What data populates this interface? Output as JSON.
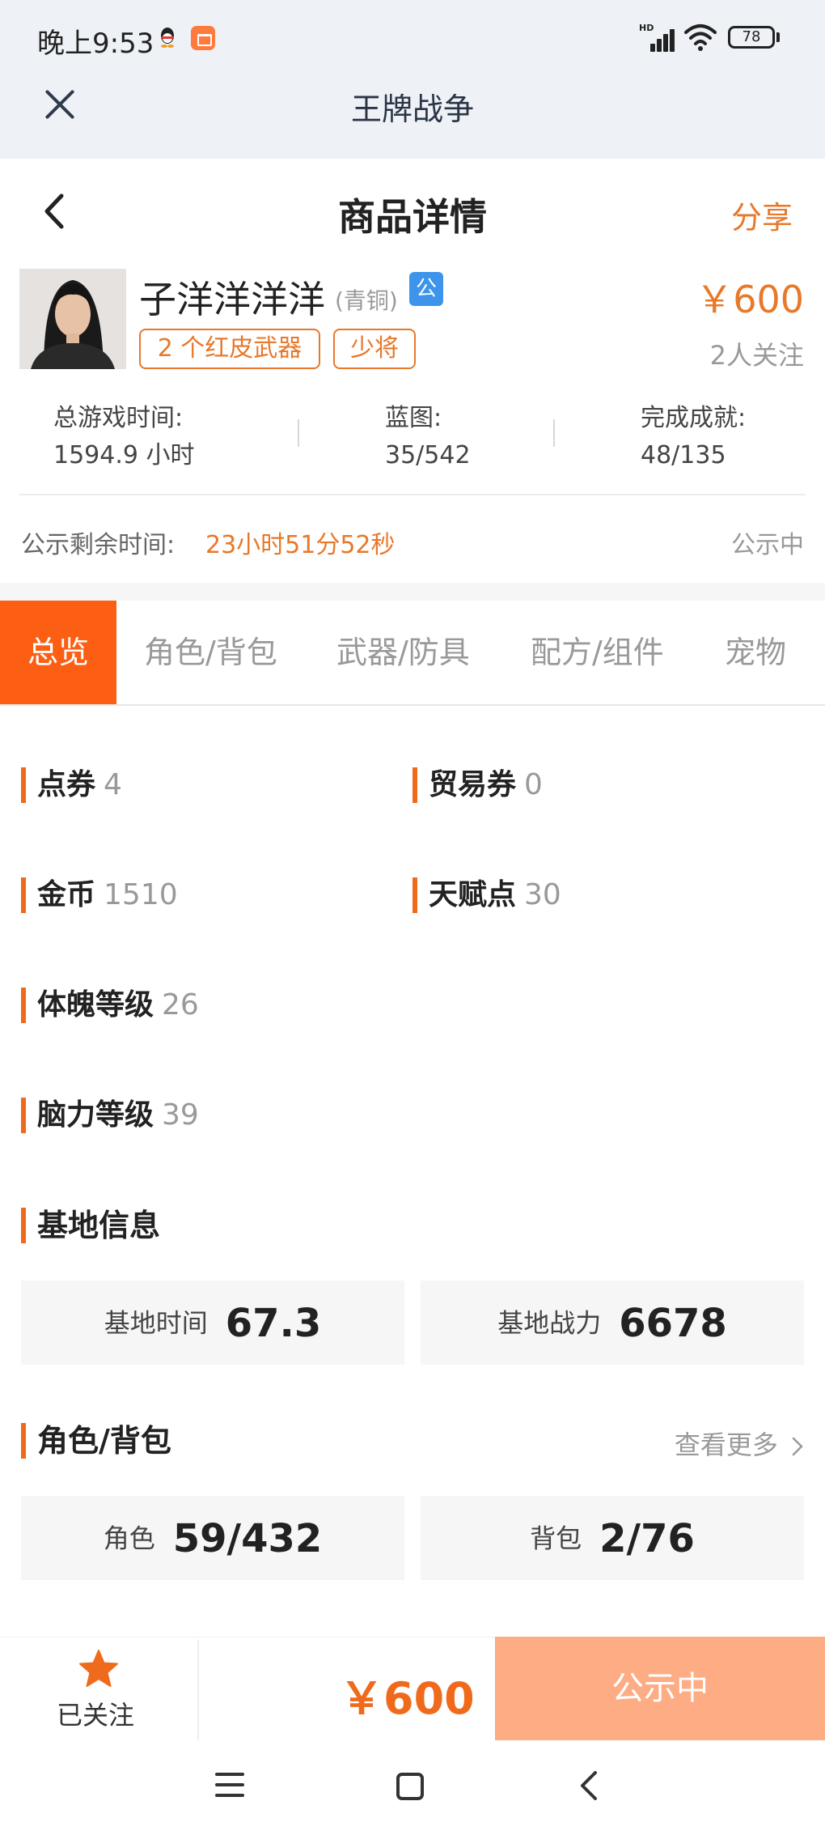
{
  "status_bar": {
    "time": "晚上9:53",
    "hd_label": "HD",
    "battery": "78"
  },
  "app_header": {
    "title": "王牌战争"
  },
  "page_header": {
    "title": "商品详情",
    "share": "分享"
  },
  "seller": {
    "name": "子洋洋洋洋",
    "rank": "(青铜)",
    "badge": "公",
    "price": "￥600",
    "tags": [
      "2 个红皮武器",
      "少将"
    ],
    "followers": "2人关注"
  },
  "stats": [
    {
      "label": "总游戏时间:",
      "value": "1594.9 小时"
    },
    {
      "label": "蓝图:",
      "value": "35/542"
    },
    {
      "label": "完成成就:",
      "value": "48/135"
    }
  ],
  "publicity": {
    "label": "公示剩余时间:",
    "remaining": "23小时51分52秒",
    "status": "公示中"
  },
  "tabs": [
    "总览",
    "角色/背包",
    "武器/防具",
    "配方/组件",
    "宠物"
  ],
  "overview": {
    "items": [
      {
        "label": "点券",
        "value": "4"
      },
      {
        "label": "贸易券",
        "value": "0"
      },
      {
        "label": "金币",
        "value": "1510"
      },
      {
        "label": "天赋点",
        "value": "30"
      },
      {
        "label": "体魄等级",
        "value": "26"
      },
      {
        "label": "脑力等级",
        "value": "39"
      }
    ],
    "base_section": {
      "title": "基地信息",
      "cards": [
        {
          "label": "基地时间",
          "value": "67.3"
        },
        {
          "label": "基地战力",
          "value": "6678"
        }
      ]
    },
    "role_section": {
      "title": "角色/背包",
      "more": "查看更多",
      "cards": [
        {
          "label": "角色",
          "value": "59/432"
        },
        {
          "label": "背包",
          "value": "2/76"
        }
      ]
    }
  },
  "bottom_bar": {
    "follow_label": "已关注",
    "price": "￥600",
    "button": "公示中"
  },
  "colors": {
    "accent": "#f06a1c",
    "tab_active": "#fc5f14",
    "cta": "#fdac84",
    "badge_blue": "#3d94ea"
  }
}
